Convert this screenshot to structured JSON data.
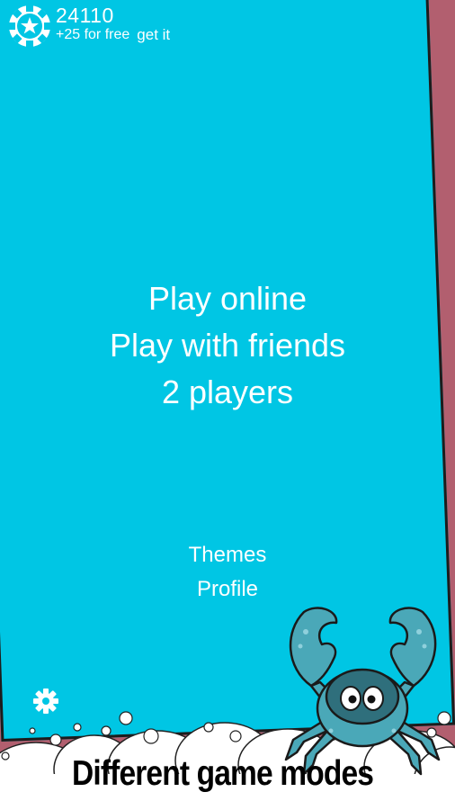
{
  "coins": {
    "count": "24110",
    "free_text": "+25 for free",
    "get_label": "get it",
    "icon": "poker-chip-icon"
  },
  "main_menu": {
    "play_online": "Play online",
    "play_with_friends": "Play with friends",
    "two_players": "2 players"
  },
  "secondary_menu": {
    "themes": "Themes",
    "profile": "Profile"
  },
  "settings_icon": "gear-icon",
  "mascot": "crab-mascot",
  "caption": "Different game modes",
  "colors": {
    "background": "#b25f6f",
    "card": "#00c6e4",
    "text": "#ffffff",
    "crab": "#4aa8b8"
  }
}
